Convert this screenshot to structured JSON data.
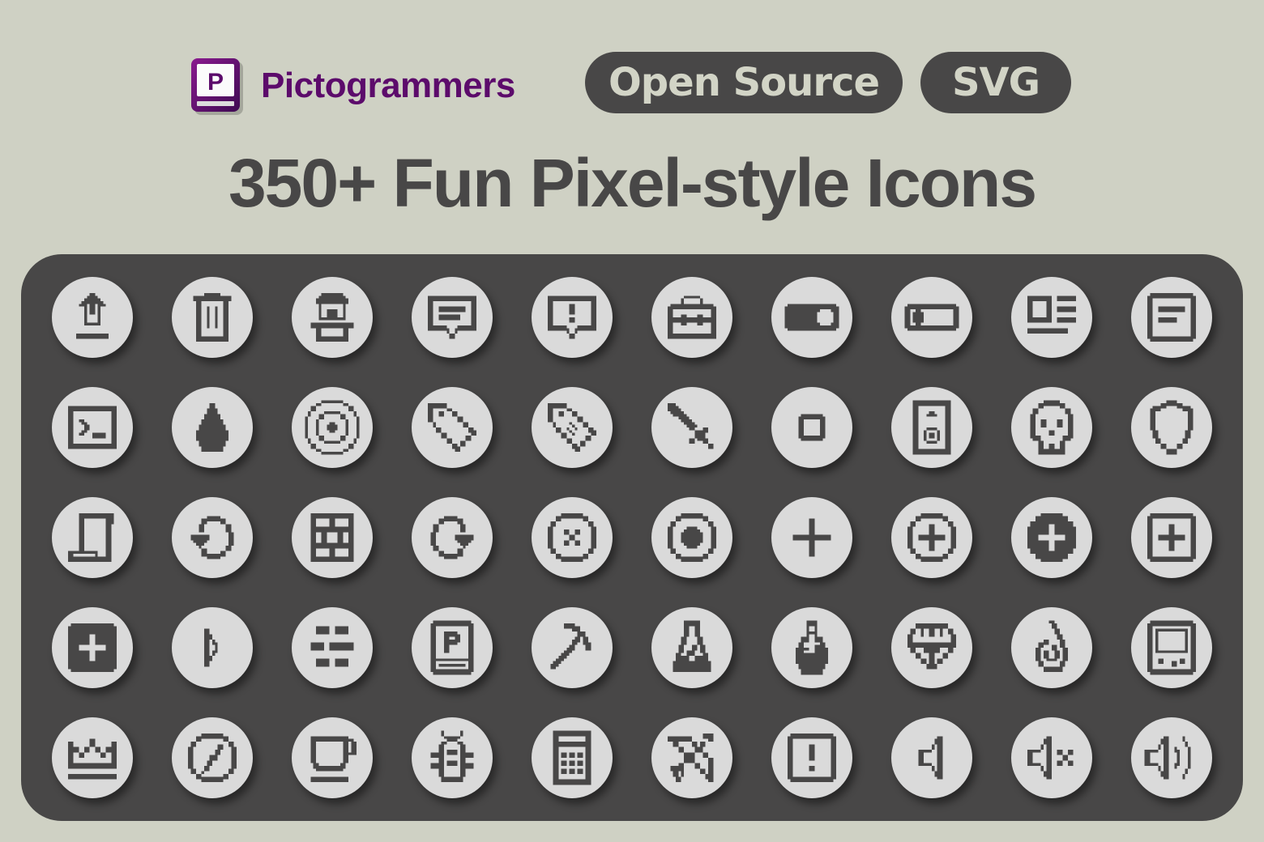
{
  "brand": {
    "name": "Pictogrammers",
    "logo_letter": "P",
    "logo_icon": "pictogrammers-book-icon",
    "color": "#5c0b6b"
  },
  "badges": {
    "open_source": "Open Source",
    "svg": "SVG"
  },
  "headline": "350+ Fun Pixel-style Icons",
  "colors": {
    "background": "#cfd1c4",
    "panel": "#484747",
    "tile": "#dadada",
    "icon": "#484747"
  },
  "icons": [
    {
      "name": "upload-icon"
    },
    {
      "name": "trash-icon"
    },
    {
      "name": "store-icon"
    },
    {
      "name": "message-text-icon"
    },
    {
      "name": "message-alert-icon"
    },
    {
      "name": "toolbox-icon"
    },
    {
      "name": "toggle-on-icon"
    },
    {
      "name": "toggle-off-icon"
    },
    {
      "name": "newspaper-icon"
    },
    {
      "name": "note-text-icon"
    },
    {
      "name": "terminal-icon"
    },
    {
      "name": "water-drop-icon"
    },
    {
      "name": "target-icon"
    },
    {
      "name": "tag-icon"
    },
    {
      "name": "tag-text-icon"
    },
    {
      "name": "sword-icon"
    },
    {
      "name": "stop-square-icon"
    },
    {
      "name": "speaker-icon"
    },
    {
      "name": "skull-icon"
    },
    {
      "name": "shield-icon"
    },
    {
      "name": "script-icon"
    },
    {
      "name": "restore-icon"
    },
    {
      "name": "wall-icon"
    },
    {
      "name": "redo-icon"
    },
    {
      "name": "close-circle-icon"
    },
    {
      "name": "radiobox-marked-icon"
    },
    {
      "name": "plus-icon"
    },
    {
      "name": "plus-circle-outline-icon"
    },
    {
      "name": "plus-circle-icon"
    },
    {
      "name": "plus-box-outline-icon"
    },
    {
      "name": "plus-box-icon"
    },
    {
      "name": "play-icon"
    },
    {
      "name": "bricks-icon"
    },
    {
      "name": "pictogrammers-icon"
    },
    {
      "name": "pickaxe-icon"
    },
    {
      "name": "flask-icon"
    },
    {
      "name": "potion-icon"
    },
    {
      "name": "diamond-icon"
    },
    {
      "name": "fire-icon"
    },
    {
      "name": "gameboy-icon"
    },
    {
      "name": "crown-icon"
    },
    {
      "name": "compass-icon"
    },
    {
      "name": "coffee-icon"
    },
    {
      "name": "bug-icon"
    },
    {
      "name": "calculator-icon"
    },
    {
      "name": "bow-arrow-icon"
    },
    {
      "name": "alert-box-icon"
    },
    {
      "name": "volume-low-icon"
    },
    {
      "name": "volume-mute-icon"
    },
    {
      "name": "volume-high-icon"
    }
  ]
}
